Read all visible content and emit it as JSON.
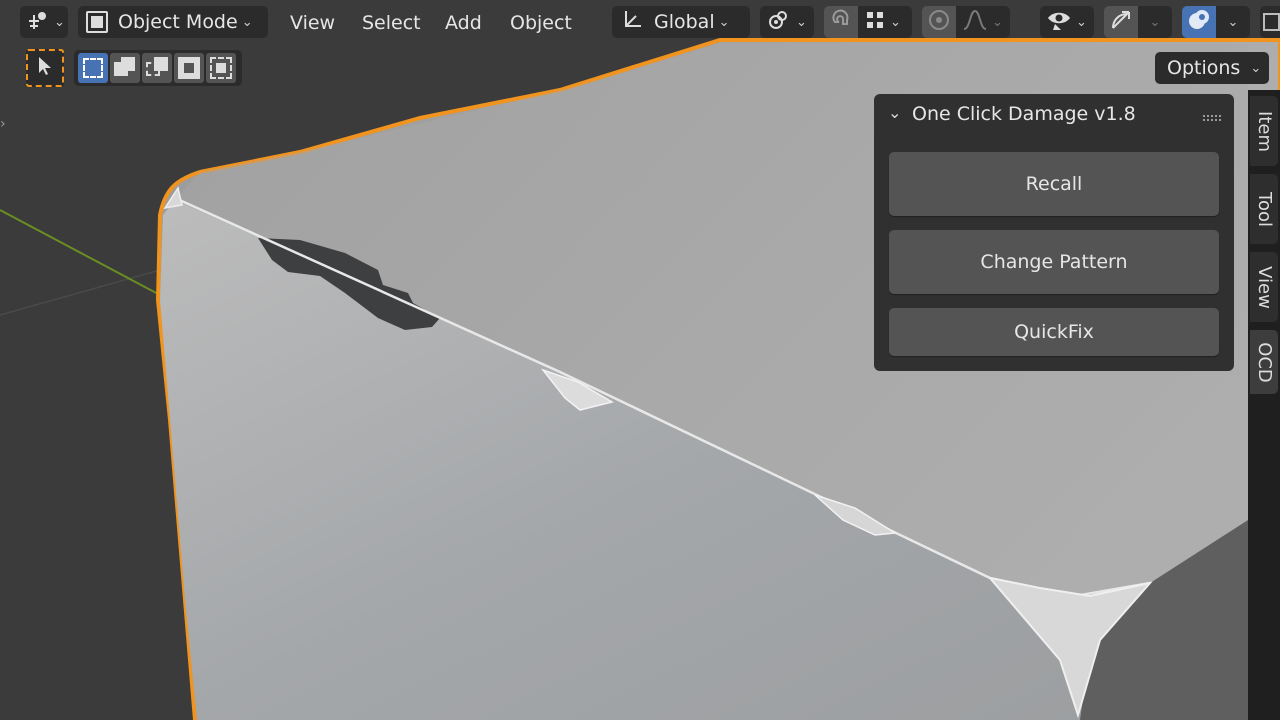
{
  "header": {
    "mode_label": "Object Mode",
    "menus": [
      "View",
      "Select",
      "Add",
      "Object"
    ],
    "transform_orientation": "Global"
  },
  "tool_header": {
    "options_label": "Options"
  },
  "panel": {
    "title": "One Click Damage v1.8",
    "buttons": [
      "Recall",
      "Change Pattern",
      "QuickFix"
    ]
  },
  "sidebar_tabs": [
    "Item",
    "Tool",
    "View",
    "OCD"
  ],
  "icons": {
    "editor_type": "editor-type-icon",
    "select_tool": "select-cursor-icon",
    "box_select_modes": [
      "select-new-icon",
      "select-extend-icon",
      "select-subtract-icon",
      "select-invert-icon",
      "select-intersect-icon"
    ],
    "pivot": "pivot-icon",
    "snap": "snap-magnet-icon",
    "snap_increment": "snap-grid-icon",
    "proportional": "proportional-edit-icon",
    "falloff": "falloff-curve-icon",
    "visibility": "eye-icon",
    "gizmo": "gizmo-icon",
    "overlays": "overlays-icon",
    "panel_grip": "drag-grip-icon"
  },
  "colors": {
    "viewport_bg": "#3b3b3b",
    "selection_outline": "#f0931f",
    "active_button": "#4772b3",
    "panel_bg": "#303030",
    "button_bg": "#545454"
  }
}
